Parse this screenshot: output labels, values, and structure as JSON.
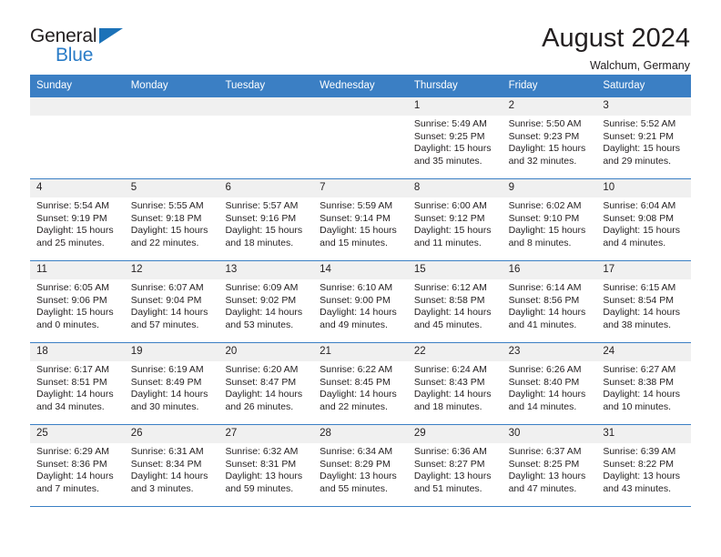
{
  "brand": {
    "name_part1": "General",
    "name_part2": "Blue",
    "flag_icon": "triangle-flag-icon"
  },
  "header": {
    "title": "August 2024",
    "location": "Walchum, Germany"
  },
  "calendar": {
    "weekdays": [
      "Sunday",
      "Monday",
      "Tuesday",
      "Wednesday",
      "Thursday",
      "Friday",
      "Saturday"
    ],
    "header_color": "#3b7fc4",
    "day_band_color": "#f0f0f0",
    "weeks": [
      [
        {
          "day": "",
          "empty": true
        },
        {
          "day": "",
          "empty": true
        },
        {
          "day": "",
          "empty": true
        },
        {
          "day": "",
          "empty": true
        },
        {
          "day": "1",
          "sunrise": "Sunrise: 5:49 AM",
          "sunset": "Sunset: 9:25 PM",
          "daylight_line1": "Daylight: 15 hours",
          "daylight_line2": "and 35 minutes."
        },
        {
          "day": "2",
          "sunrise": "Sunrise: 5:50 AM",
          "sunset": "Sunset: 9:23 PM",
          "daylight_line1": "Daylight: 15 hours",
          "daylight_line2": "and 32 minutes."
        },
        {
          "day": "3",
          "sunrise": "Sunrise: 5:52 AM",
          "sunset": "Sunset: 9:21 PM",
          "daylight_line1": "Daylight: 15 hours",
          "daylight_line2": "and 29 minutes."
        }
      ],
      [
        {
          "day": "4",
          "sunrise": "Sunrise: 5:54 AM",
          "sunset": "Sunset: 9:19 PM",
          "daylight_line1": "Daylight: 15 hours",
          "daylight_line2": "and 25 minutes."
        },
        {
          "day": "5",
          "sunrise": "Sunrise: 5:55 AM",
          "sunset": "Sunset: 9:18 PM",
          "daylight_line1": "Daylight: 15 hours",
          "daylight_line2": "and 22 minutes."
        },
        {
          "day": "6",
          "sunrise": "Sunrise: 5:57 AM",
          "sunset": "Sunset: 9:16 PM",
          "daylight_line1": "Daylight: 15 hours",
          "daylight_line2": "and 18 minutes."
        },
        {
          "day": "7",
          "sunrise": "Sunrise: 5:59 AM",
          "sunset": "Sunset: 9:14 PM",
          "daylight_line1": "Daylight: 15 hours",
          "daylight_line2": "and 15 minutes."
        },
        {
          "day": "8",
          "sunrise": "Sunrise: 6:00 AM",
          "sunset": "Sunset: 9:12 PM",
          "daylight_line1": "Daylight: 15 hours",
          "daylight_line2": "and 11 minutes."
        },
        {
          "day": "9",
          "sunrise": "Sunrise: 6:02 AM",
          "sunset": "Sunset: 9:10 PM",
          "daylight_line1": "Daylight: 15 hours",
          "daylight_line2": "and 8 minutes."
        },
        {
          "day": "10",
          "sunrise": "Sunrise: 6:04 AM",
          "sunset": "Sunset: 9:08 PM",
          "daylight_line1": "Daylight: 15 hours",
          "daylight_line2": "and 4 minutes."
        }
      ],
      [
        {
          "day": "11",
          "sunrise": "Sunrise: 6:05 AM",
          "sunset": "Sunset: 9:06 PM",
          "daylight_line1": "Daylight: 15 hours",
          "daylight_line2": "and 0 minutes."
        },
        {
          "day": "12",
          "sunrise": "Sunrise: 6:07 AM",
          "sunset": "Sunset: 9:04 PM",
          "daylight_line1": "Daylight: 14 hours",
          "daylight_line2": "and 57 minutes."
        },
        {
          "day": "13",
          "sunrise": "Sunrise: 6:09 AM",
          "sunset": "Sunset: 9:02 PM",
          "daylight_line1": "Daylight: 14 hours",
          "daylight_line2": "and 53 minutes."
        },
        {
          "day": "14",
          "sunrise": "Sunrise: 6:10 AM",
          "sunset": "Sunset: 9:00 PM",
          "daylight_line1": "Daylight: 14 hours",
          "daylight_line2": "and 49 minutes."
        },
        {
          "day": "15",
          "sunrise": "Sunrise: 6:12 AM",
          "sunset": "Sunset: 8:58 PM",
          "daylight_line1": "Daylight: 14 hours",
          "daylight_line2": "and 45 minutes."
        },
        {
          "day": "16",
          "sunrise": "Sunrise: 6:14 AM",
          "sunset": "Sunset: 8:56 PM",
          "daylight_line1": "Daylight: 14 hours",
          "daylight_line2": "and 41 minutes."
        },
        {
          "day": "17",
          "sunrise": "Sunrise: 6:15 AM",
          "sunset": "Sunset: 8:54 PM",
          "daylight_line1": "Daylight: 14 hours",
          "daylight_line2": "and 38 minutes."
        }
      ],
      [
        {
          "day": "18",
          "sunrise": "Sunrise: 6:17 AM",
          "sunset": "Sunset: 8:51 PM",
          "daylight_line1": "Daylight: 14 hours",
          "daylight_line2": "and 34 minutes."
        },
        {
          "day": "19",
          "sunrise": "Sunrise: 6:19 AM",
          "sunset": "Sunset: 8:49 PM",
          "daylight_line1": "Daylight: 14 hours",
          "daylight_line2": "and 30 minutes."
        },
        {
          "day": "20",
          "sunrise": "Sunrise: 6:20 AM",
          "sunset": "Sunset: 8:47 PM",
          "daylight_line1": "Daylight: 14 hours",
          "daylight_line2": "and 26 minutes."
        },
        {
          "day": "21",
          "sunrise": "Sunrise: 6:22 AM",
          "sunset": "Sunset: 8:45 PM",
          "daylight_line1": "Daylight: 14 hours",
          "daylight_line2": "and 22 minutes."
        },
        {
          "day": "22",
          "sunrise": "Sunrise: 6:24 AM",
          "sunset": "Sunset: 8:43 PM",
          "daylight_line1": "Daylight: 14 hours",
          "daylight_line2": "and 18 minutes."
        },
        {
          "day": "23",
          "sunrise": "Sunrise: 6:26 AM",
          "sunset": "Sunset: 8:40 PM",
          "daylight_line1": "Daylight: 14 hours",
          "daylight_line2": "and 14 minutes."
        },
        {
          "day": "24",
          "sunrise": "Sunrise: 6:27 AM",
          "sunset": "Sunset: 8:38 PM",
          "daylight_line1": "Daylight: 14 hours",
          "daylight_line2": "and 10 minutes."
        }
      ],
      [
        {
          "day": "25",
          "sunrise": "Sunrise: 6:29 AM",
          "sunset": "Sunset: 8:36 PM",
          "daylight_line1": "Daylight: 14 hours",
          "daylight_line2": "and 7 minutes."
        },
        {
          "day": "26",
          "sunrise": "Sunrise: 6:31 AM",
          "sunset": "Sunset: 8:34 PM",
          "daylight_line1": "Daylight: 14 hours",
          "daylight_line2": "and 3 minutes."
        },
        {
          "day": "27",
          "sunrise": "Sunrise: 6:32 AM",
          "sunset": "Sunset: 8:31 PM",
          "daylight_line1": "Daylight: 13 hours",
          "daylight_line2": "and 59 minutes."
        },
        {
          "day": "28",
          "sunrise": "Sunrise: 6:34 AM",
          "sunset": "Sunset: 8:29 PM",
          "daylight_line1": "Daylight: 13 hours",
          "daylight_line2": "and 55 minutes."
        },
        {
          "day": "29",
          "sunrise": "Sunrise: 6:36 AM",
          "sunset": "Sunset: 8:27 PM",
          "daylight_line1": "Daylight: 13 hours",
          "daylight_line2": "and 51 minutes."
        },
        {
          "day": "30",
          "sunrise": "Sunrise: 6:37 AM",
          "sunset": "Sunset: 8:25 PM",
          "daylight_line1": "Daylight: 13 hours",
          "daylight_line2": "and 47 minutes."
        },
        {
          "day": "31",
          "sunrise": "Sunrise: 6:39 AM",
          "sunset": "Sunset: 8:22 PM",
          "daylight_line1": "Daylight: 13 hours",
          "daylight_line2": "and 43 minutes."
        }
      ]
    ]
  }
}
